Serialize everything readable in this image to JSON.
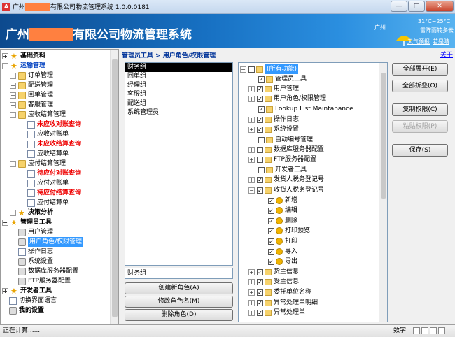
{
  "window": {
    "title_prefix": "广州",
    "title_suffix": "有限公司物流管理系统 1.0.0.0181",
    "min": "—",
    "max": "□",
    "close": "✕"
  },
  "banner": {
    "title_prefix": "广州",
    "title_suffix": "有限公司物流管理系统",
    "city": "广州",
    "temp": "31°C~25°C",
    "weather": "雷阵雨转多云",
    "link1": "天气预报",
    "link2": "若是晴"
  },
  "about": "关于",
  "nav": {
    "items": [
      {
        "label": "基础资料"
      },
      {
        "label": "运输管理"
      },
      {
        "label": "订单管理"
      },
      {
        "label": "配送管理"
      },
      {
        "label": "回单管理"
      },
      {
        "label": "客服管理"
      },
      {
        "label": "应收结算管理"
      },
      {
        "label": "未应收对账查询"
      },
      {
        "label": "应收对账单"
      },
      {
        "label": "未应收结算查询"
      },
      {
        "label": "应收结算单"
      },
      {
        "label": "应付结算管理"
      },
      {
        "label": "待应付对账查询"
      },
      {
        "label": "应付对账单"
      },
      {
        "label": "待应付结算查询"
      },
      {
        "label": "应付结算单"
      },
      {
        "label": "决策分析"
      },
      {
        "label": "管理员工具"
      },
      {
        "label": "用户管理"
      },
      {
        "label": "用户角色/权限管理"
      },
      {
        "label": "操作日志"
      },
      {
        "label": "系统设置"
      },
      {
        "label": "数据库服务器配置"
      },
      {
        "label": "FTP服务器配置"
      },
      {
        "label": "开发者工具"
      },
      {
        "label": "切换界面语言"
      },
      {
        "label": "我的设置"
      }
    ]
  },
  "breadcrumb": "管理员工具 > 用户角色/权限管理",
  "roles": [
    "财务组",
    "回单组",
    "经理组",
    "客服组",
    "配送组",
    "系统管理员"
  ],
  "role_name_value": "财务组",
  "role_buttons": {
    "create": "创建新角色(A)",
    "rename": "修改角色名(M)",
    "delete": "删除角色(D)"
  },
  "perms": [
    "(所有功能)",
    "管理员工具",
    "用户管理",
    "用户角色/权限管理",
    "Lookup List Maintanance",
    "操作日志",
    "系统设置",
    "自动编号管理",
    "数据库服务器配置",
    "FTP服务器配置",
    "开发者工具",
    "发货人税务登记号",
    "收货人税务登记号",
    "新增",
    "编辑",
    "删除",
    "打印预览",
    "打印",
    "导入",
    "导出",
    "货主信息",
    "受主信息",
    "委托单位名称",
    "异常处理单明细",
    "异常处理单"
  ],
  "actions": {
    "expand": "全部展开(E)",
    "collapse": "全部折叠(O)",
    "copy": "复制权限(C)",
    "paste": "粘贴权限(P)",
    "save": "保存(S)"
  },
  "status": {
    "left": "正在计算......",
    "right": "数字"
  }
}
